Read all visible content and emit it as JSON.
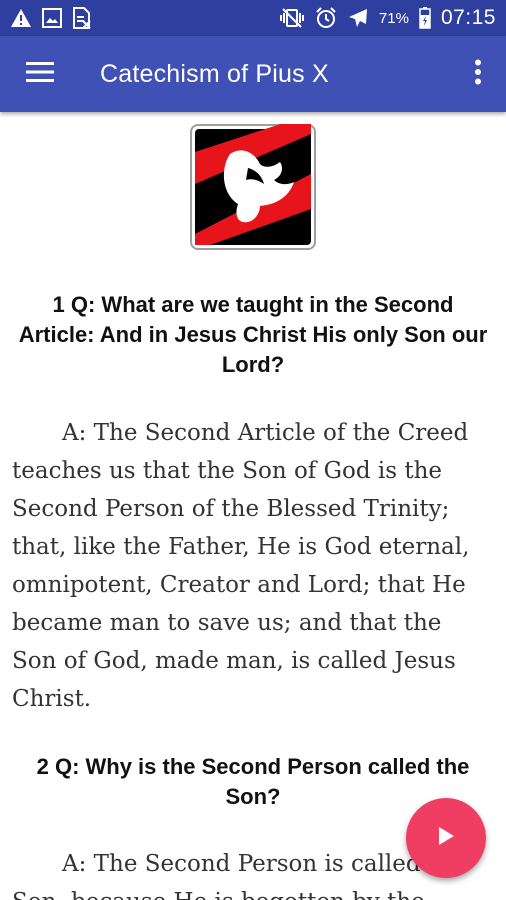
{
  "status_bar": {
    "icons_left": [
      "warning-icon",
      "image-icon",
      "doc-icon"
    ],
    "icons_right": [
      "vibrate-icon",
      "alarm-icon",
      "airplane-icon",
      "battery-icon"
    ],
    "battery_percent": "71%",
    "time": "07:15"
  },
  "app_bar": {
    "title": "Catechism of Pius X",
    "menu_icon": "hamburger-menu-icon",
    "overflow_icon": "more-vert-icon"
  },
  "content": {
    "logo_icon": "dove-logo-icon",
    "q1": "1 Q: What are we taught in the Second Article: And in Jesus Christ His only Son our Lord?",
    "a1": "A: The Second Article of the Creed teaches us that the Son of God is the Second Person of the Blessed Trinity; that, like the Father, He is God eternal, omnipotent, Creator and Lord; that He became man to save us; and that the Son of God, made man, is called Jesus Christ.",
    "q2": "2 Q: Why is the Second Person called the Son?",
    "a2": "A: The Second Person is called the Son, because He is begotten by the"
  },
  "fab": {
    "icon": "play-icon"
  },
  "colors": {
    "status_bar": "#2f3fa0",
    "app_bar": "#3f51b5",
    "fab": "#ef3e62",
    "logo_red": "#e8141c"
  }
}
